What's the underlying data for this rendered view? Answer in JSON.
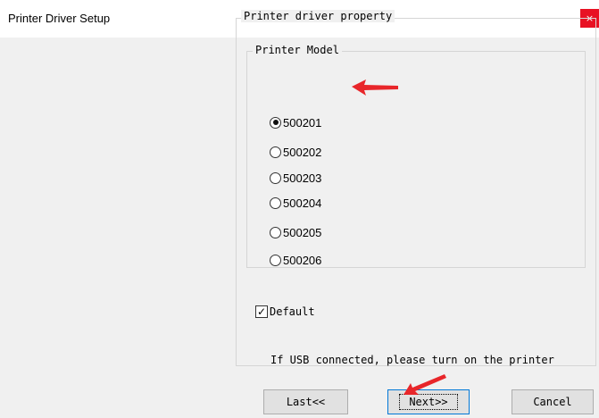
{
  "window": {
    "title": "Printer Driver Setup",
    "close_glyph": "×"
  },
  "property_group": {
    "label": "Printer driver property"
  },
  "model_group": {
    "label": "Printer Model",
    "options": [
      "500201",
      "500202",
      "500203",
      "500204",
      "500205",
      "500206"
    ],
    "selected": "500201"
  },
  "default_checkbox": {
    "label": "Default",
    "checked": true,
    "check_glyph": "✓"
  },
  "hint_text": "If USB connected, please turn on the printer",
  "buttons": {
    "last": "Last<<",
    "next": "Next>>",
    "cancel": "Cancel"
  },
  "colors": {
    "annotation_arrow": "#e8262a",
    "close_button": "#e81123",
    "focus_border": "#0078d7"
  }
}
